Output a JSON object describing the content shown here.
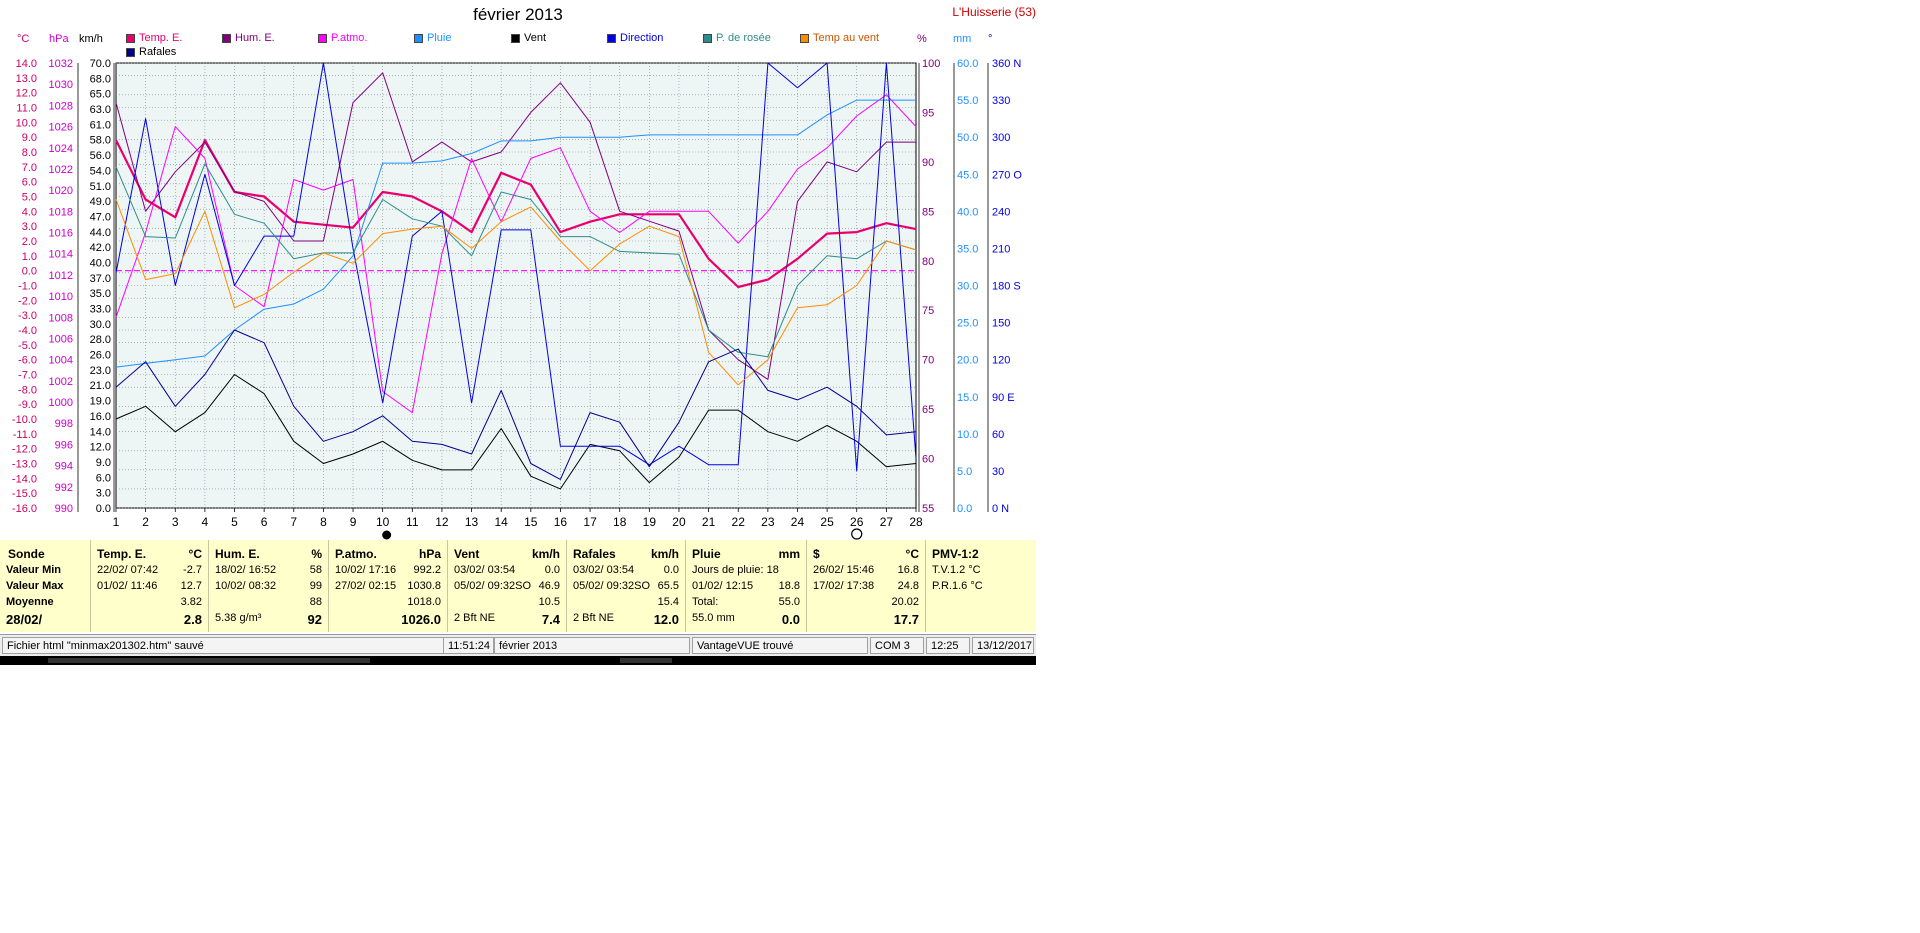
{
  "title": "février 2013",
  "station": "L'Huisserie (53)",
  "axis_units": {
    "temp": "°C",
    "hpa": "hPa",
    "kmh": "km/h",
    "pct": "%",
    "mm": "mm",
    "deg": "°"
  },
  "legend": [
    {
      "label": "Temp. E.",
      "color": "#e8006e"
    },
    {
      "label": "Hum. E.",
      "color": "#800080"
    },
    {
      "label": "P.atmo.",
      "color": "#ff00ff"
    },
    {
      "label": "Pluie",
      "color": "#1e90ff"
    },
    {
      "label": "Vent",
      "color": "#000000"
    },
    {
      "label": "Direction",
      "color": "#0000e0"
    },
    {
      "label": "P. de rosée",
      "color": "#2e8b8b"
    },
    {
      "label": "Temp au vent",
      "color": "#ff8c00"
    },
    {
      "label": "Rafales",
      "color": "#00008b"
    }
  ],
  "chart_data": {
    "type": "line",
    "x": [
      1,
      2,
      3,
      4,
      5,
      6,
      7,
      8,
      9,
      10,
      11,
      12,
      13,
      14,
      15,
      16,
      17,
      18,
      19,
      20,
      21,
      22,
      23,
      24,
      25,
      26,
      27,
      28
    ],
    "xlim": [
      1,
      28
    ],
    "x_ticks": [
      "1",
      "2",
      "3",
      "4",
      "5",
      "6",
      "7",
      "8",
      "9",
      "10",
      "11",
      "12",
      "13",
      "14",
      "15",
      "16",
      "17",
      "18",
      "19",
      "20",
      "21",
      "22",
      "23",
      "24",
      "25",
      "26",
      "27",
      "28"
    ],
    "axes": {
      "temp": {
        "min": -16,
        "max": 14,
        "ticks": [
          "14.0",
          "13.0",
          "12.0",
          "11.0",
          "10.0",
          "9.0",
          "8.0",
          "7.0",
          "6.0",
          "5.0",
          "4.0",
          "3.0",
          "2.0",
          "1.0",
          "0.0",
          "-1.0",
          "-2.0",
          "-3.0",
          "-4.0",
          "-5.0",
          "-6.0",
          "-7.0",
          "-8.0",
          "-9.0",
          "-10.0",
          "-11.0",
          "-12.0",
          "-13.0",
          "-14.0",
          "-15.0",
          "-16.0"
        ]
      },
      "hpa": {
        "min": 990,
        "max": 1032,
        "ticks": [
          "1032",
          "1030",
          "1028",
          "1026",
          "1024",
          "1022",
          "1020",
          "1018",
          "1016",
          "1014",
          "1012",
          "1010",
          "1008",
          "1006",
          "1004",
          "1002",
          "1000",
          "998",
          "996",
          "994",
          "992",
          "990"
        ]
      },
      "kmh": {
        "min": 0,
        "max": 70,
        "ticks": [
          "70.0",
          "68.0",
          "65.0",
          "63.0",
          "61.0",
          "58.0",
          "56.0",
          "54.0",
          "51.0",
          "49.0",
          "47.0",
          "44.0",
          "42.0",
          "40.0",
          "37.0",
          "35.0",
          "33.0",
          "30.0",
          "28.0",
          "26.0",
          "23.0",
          "21.0",
          "19.0",
          "16.0",
          "14.0",
          "12.0",
          "9.0",
          "6.0",
          "3.0",
          "0.0"
        ]
      },
      "pct": {
        "min": 55,
        "max": 100,
        "ticks": [
          "100",
          "95",
          "90",
          "85",
          "80",
          "75",
          "70",
          "65",
          "60",
          "55"
        ]
      },
      "mm": {
        "min": 0,
        "max": 60,
        "ticks": [
          "60.0",
          "55.0",
          "50.0",
          "45.0",
          "40.0",
          "35.0",
          "30.0",
          "25.0",
          "20.0",
          "15.0",
          "10.0",
          "5.0",
          "0.0"
        ]
      },
      "deg": {
        "min": 0,
        "max": 360,
        "ticks": [
          "360 N",
          "330",
          "300",
          "270 O",
          "240",
          "210",
          "180 S",
          "150",
          "120",
          "90 E",
          "60",
          "30",
          "0 N"
        ]
      }
    },
    "zero_line": {
      "axis": "temp",
      "value": 0
    },
    "series": [
      {
        "name": "Temp. E.",
        "axis": "temp",
        "color": "#e8006e",
        "width": 2.2,
        "values": [
          8.8,
          4.8,
          3.6,
          8.8,
          5.3,
          5.0,
          3.3,
          3.1,
          2.9,
          5.3,
          5.0,
          4.0,
          2.6,
          6.6,
          5.8,
          2.6,
          3.3,
          3.8,
          3.8,
          3.8,
          0.8,
          -1.1,
          -0.6,
          0.8,
          2.5,
          2.6,
          3.2,
          2.8
        ]
      },
      {
        "name": "Hum. E.",
        "axis": "pct",
        "color": "#800080",
        "width": 1,
        "values": [
          96,
          85,
          89,
          92,
          87,
          86,
          82,
          82,
          96,
          99,
          90,
          92,
          90,
          91,
          95,
          98,
          94,
          85,
          84,
          83,
          73,
          70,
          68,
          86,
          90,
          89,
          92,
          92
        ]
      },
      {
        "name": "P.atmo.",
        "axis": "hpa",
        "color": "#ff00ff",
        "width": 1,
        "values": [
          1008,
          1016,
          1026,
          1023,
          1011,
          1009,
          1021,
          1020,
          1021,
          1001,
          999,
          1014,
          1023,
          1017,
          1023,
          1024,
          1018,
          1016,
          1018,
          1018,
          1018,
          1015,
          1018,
          1022,
          1024,
          1027,
          1029,
          1026
        ]
      },
      {
        "name": "Pluie",
        "axis": "mm",
        "color": "#1e90ff",
        "width": 1,
        "values": [
          19.0,
          19.5,
          20.0,
          20.5,
          24.0,
          26.8,
          27.5,
          29.5,
          34.0,
          46.5,
          46.5,
          46.8,
          47.8,
          49.5,
          49.5,
          50.0,
          50.0,
          50.0,
          50.3,
          50.3,
          50.3,
          50.3,
          50.3,
          50.3,
          53.0,
          55.0,
          55.0,
          55.0
        ]
      },
      {
        "name": "Vent",
        "axis": "kmh",
        "color": "#000000",
        "width": 1,
        "values": [
          14.0,
          16.0,
          12.0,
          15.0,
          21.0,
          18.0,
          10.5,
          7.0,
          8.5,
          10.5,
          7.5,
          6.0,
          6.0,
          12.5,
          5.0,
          3.0,
          10.0,
          9.0,
          4.0,
          8.0,
          15.4,
          15.4,
          12.0,
          10.5,
          13.0,
          10.5,
          6.5,
          7.0
        ]
      },
      {
        "name": "Direction",
        "axis": "deg",
        "color": "#0000e0",
        "width": 1,
        "values": [
          190,
          315,
          180,
          270,
          180,
          220,
          220,
          360,
          210,
          85,
          220,
          240,
          85,
          225,
          225,
          50,
          50,
          50,
          35,
          50,
          35,
          35,
          360,
          340,
          360,
          30,
          360,
          40
        ]
      },
      {
        "name": "P. de rosée",
        "axis": "temp",
        "color": "#2e8b8b",
        "width": 1,
        "values": [
          7.0,
          2.3,
          2.2,
          7.2,
          3.8,
          3.2,
          0.8,
          1.2,
          1.2,
          4.8,
          3.5,
          3.0,
          1.0,
          5.3,
          4.8,
          2.3,
          2.3,
          1.3,
          1.2,
          1.1,
          -4.0,
          -5.5,
          -5.8,
          -1.0,
          1.0,
          0.8,
          2.0,
          1.4
        ]
      },
      {
        "name": "Temp au vent",
        "axis": "temp",
        "color": "#ff8c00",
        "width": 1,
        "values": [
          4.8,
          -0.6,
          -0.2,
          4.0,
          -2.5,
          -1.6,
          -0.1,
          1.2,
          0.5,
          2.5,
          2.8,
          3.0,
          1.5,
          3.3,
          4.3,
          2.0,
          0.0,
          1.8,
          3.0,
          2.3,
          -5.5,
          -7.7,
          -6.0,
          -2.5,
          -2.3,
          -1.0,
          2.0,
          1.4
        ]
      },
      {
        "name": "Rafales",
        "axis": "kmh",
        "color": "#00008b",
        "width": 1,
        "values": [
          19.0,
          23.0,
          16.0,
          21.0,
          28.0,
          26.0,
          16.0,
          10.5,
          12.0,
          14.5,
          10.5,
          10.0,
          8.5,
          18.5,
          7.0,
          4.5,
          15.0,
          13.5,
          6.5,
          13.5,
          23.0,
          25.0,
          18.5,
          17.0,
          19.0,
          16.0,
          11.5,
          12.0
        ]
      }
    ]
  },
  "stats": {
    "sonde": {
      "head": "Sonde",
      "rows": [
        "Valeur Min",
        "Valeur Max",
        "Moyenne",
        "28/02/"
      ]
    },
    "temp": {
      "head": "Temp. E.",
      "unit": "°C",
      "min_time": "22/02/  07:42",
      "min_val": "-2.7",
      "max_time": "01/02/  11:46",
      "max_val": "12.7",
      "avg": "3.82",
      "cur": "2.8"
    },
    "hum": {
      "head": "Hum. E.",
      "unit": "%",
      "min_time": "18/02/  16:52",
      "min_val": "58",
      "max_time": "10/02/  08:32",
      "max_val": "99",
      "avg": "88",
      "cur_label": "5.38 g/m³",
      "cur": "92"
    },
    "patmo": {
      "head": "P.atmo.",
      "unit": "hPa",
      "min_time": "10/02/  17:16",
      "min_val": "992.2",
      "max_time": "27/02/  02:15",
      "max_val": "1030.8",
      "avg": "1018.0",
      "cur": "1026.0"
    },
    "vent": {
      "head": "Vent",
      "unit": "km/h",
      "min_time": "03/02/  03:54",
      "min_val": "0.0",
      "max_time": "05/02/  09:32SO",
      "max_val": "46.9",
      "avg": "10.5",
      "cur_label": "2 Bft NE",
      "cur": "7.4"
    },
    "rafales": {
      "head": "Rafales",
      "unit": "km/h",
      "min_time": "03/02/  03:54",
      "min_val": "0.0",
      "max_time": "05/02/  09:32SO",
      "max_val": "65.5",
      "avg": "15.4",
      "cur_label": "2 Bft NE",
      "cur": "12.0"
    },
    "pluie": {
      "head": "Pluie",
      "unit": "mm",
      "row1": "Jours de pluie: 18",
      "max_time": "01/02/  12:15",
      "max_val": "18.8",
      "total_label": "Total:",
      "total_val": "55.0",
      "cur_label": "55.0 mm",
      "cur": "0.0"
    },
    "s": {
      "head": "$",
      "unit": "°C",
      "min_time": "26/02/  15:46",
      "min_val": "16.8",
      "max_time": "17/02/  17:38",
      "max_val": "24.8",
      "avg": "20.02",
      "cur": "17.7"
    },
    "pmv": {
      "head": "PMV-1:2",
      "row1": "T.V.1.2 °C",
      "row2": "P.R.1.6 °C"
    }
  },
  "statusbar": {
    "file_msg": "Fichier html  \"minmax201302.htm\"  sauvé",
    "time": "11:51:24",
    "month": "février 2013",
    "device": "VantageVUE trouvé",
    "port": "COM 3",
    "clock": "12:25",
    "date": "13/12/2017"
  }
}
